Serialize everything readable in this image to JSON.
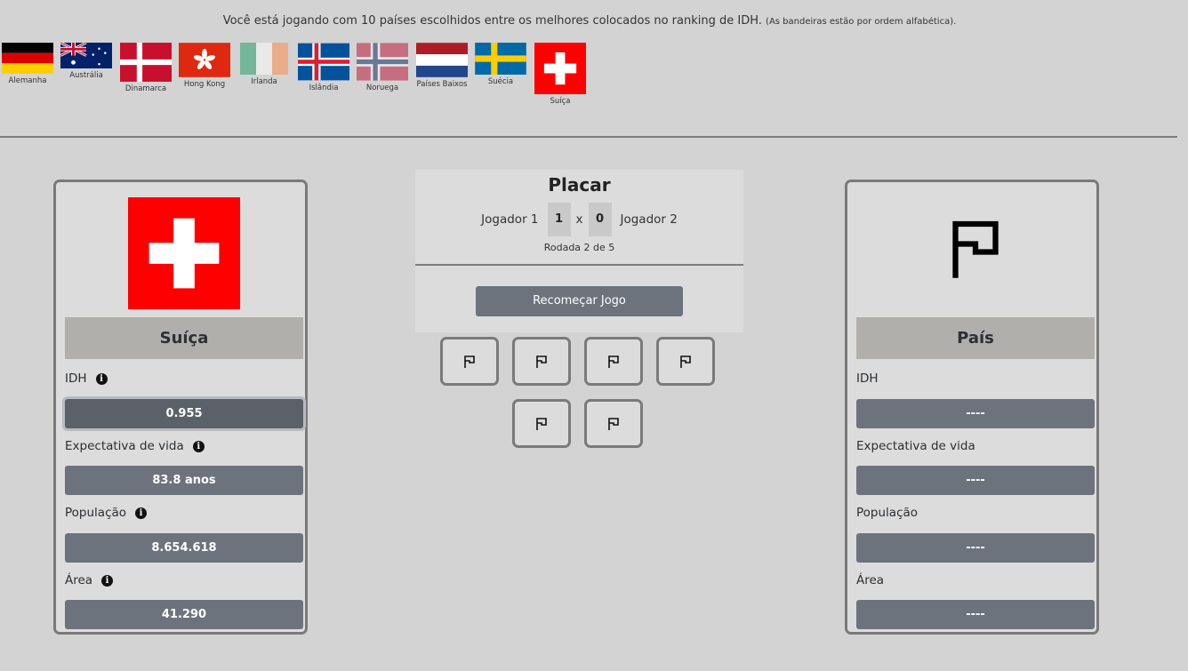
{
  "intro": {
    "text": "Você está jogando com 10 países escolhidos entre os melhores colocados no ranking de IDH.",
    "note": "(As bandeiras estão por ordem alfabética)."
  },
  "flags": [
    {
      "name": "Alemanha",
      "icon": "germany-flag-icon"
    },
    {
      "name": "Austrália",
      "icon": "australia-flag-icon"
    },
    {
      "name": "Dinamarca",
      "icon": "denmark-flag-icon"
    },
    {
      "name": "Hong Kong",
      "icon": "hong-kong-flag-icon"
    },
    {
      "name": "Irlanda",
      "icon": "ireland-flag-icon"
    },
    {
      "name": "Islândia",
      "icon": "iceland-flag-icon"
    },
    {
      "name": "Noruega",
      "icon": "norway-flag-icon"
    },
    {
      "name": "Países Baixos",
      "icon": "netherlands-flag-icon"
    },
    {
      "name": "Suécia",
      "icon": "sweden-flag-icon"
    },
    {
      "name": "Suíça",
      "icon": "switzerland-flag-icon"
    }
  ],
  "left_card": {
    "country": "Suíça",
    "flag_icon": "switzerland-flag-icon",
    "stats": [
      {
        "label": "IDH",
        "value": "0.955"
      },
      {
        "label": "Expectativa de vida",
        "value": "83.8 anos"
      },
      {
        "label": "População",
        "value": "8.654.618"
      },
      {
        "label": "Área",
        "value": "41.290"
      }
    ]
  },
  "right_card": {
    "country": "País",
    "flag_icon": "flag-icon",
    "stats": [
      {
        "label": "IDH",
        "value": "----"
      },
      {
        "label": "Expectativa de vida",
        "value": "----"
      },
      {
        "label": "População",
        "value": "----"
      },
      {
        "label": "Área",
        "value": "----"
      }
    ]
  },
  "score": {
    "title": "Placar",
    "player1": "Jogador 1",
    "player1_score": "1",
    "separator": "x",
    "player2_score": "0",
    "player2": "Jogador 2",
    "round": "Rodada 2 de 5",
    "restart_label": "Recomeçar Jogo"
  },
  "card_slots_icon": "flag-icon",
  "info_icon_glyph": "i",
  "colors": {
    "background": "#d3d3d3",
    "card_border": "#7a7a7a",
    "value_button": "#6c737c",
    "name_bar": "#b0afab"
  }
}
